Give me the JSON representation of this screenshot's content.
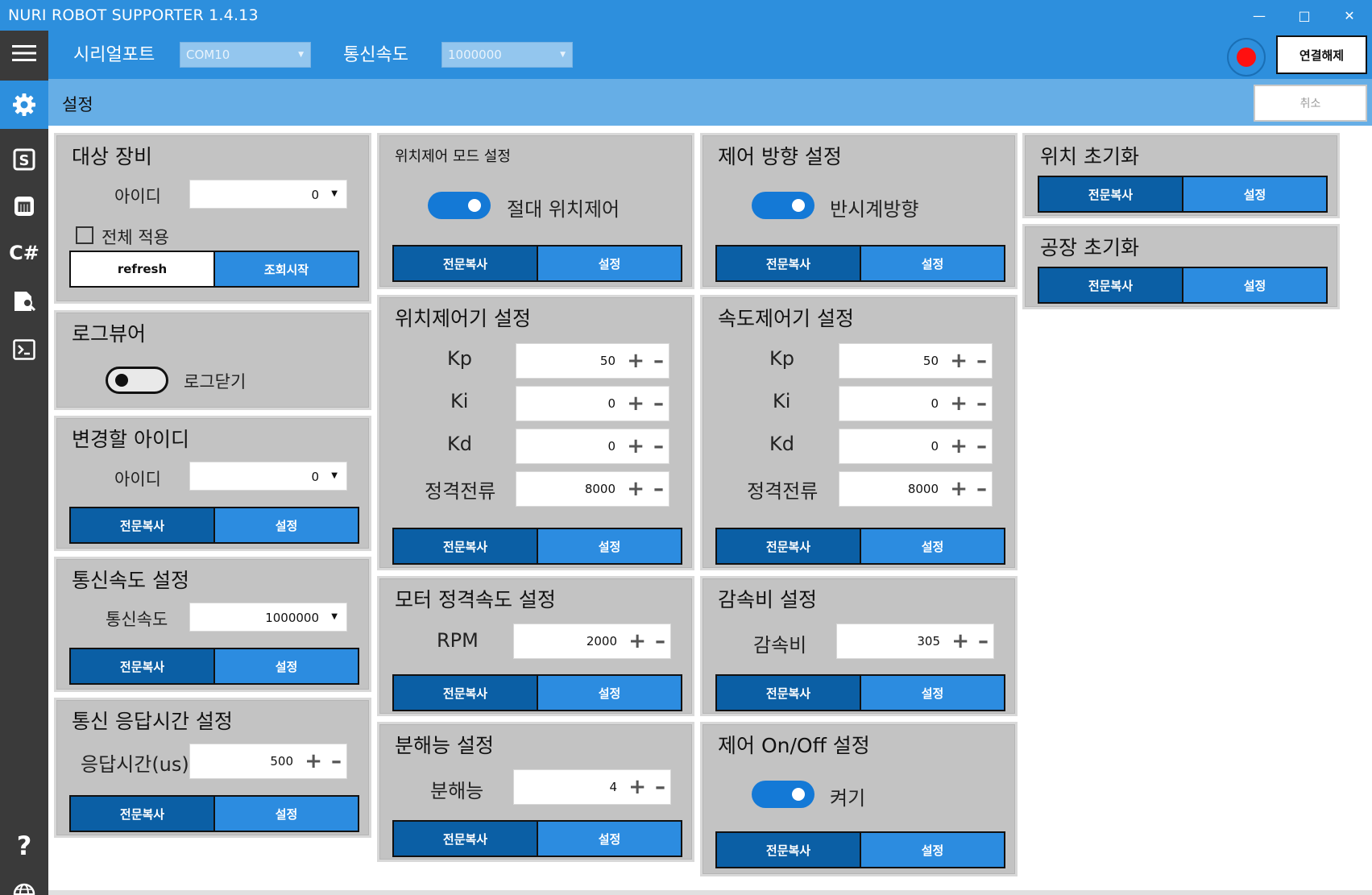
{
  "window": {
    "title": "NURI ROBOT SUPPORTER 1.4.13"
  },
  "topbar": {
    "serial_label": "시리얼포트",
    "serial_value": "COM10",
    "baud_label": "통신속도",
    "baud_value": "1000000",
    "disconnect_label": "연결해제"
  },
  "subheader": {
    "title": "설정",
    "cancel_label": "취소"
  },
  "sidebar": {
    "icons": [
      "menu-icon",
      "gear-icon",
      "s-icon",
      "m-icon",
      "csharp-icon",
      "doc-search-icon",
      "terminal-icon",
      "help-icon",
      "globe-icon"
    ],
    "csharp_text": "C#",
    "help_text": "?"
  },
  "buttons": {
    "copy": "전문복사",
    "set": "설정"
  },
  "target_device": {
    "title": "대상 장비",
    "id_label": "아이디",
    "id_value": "0",
    "apply_all_label": "전체 적용",
    "refresh_label": "refresh",
    "start_query_label": "조회시작"
  },
  "log_viewer": {
    "title": "로그뷰어",
    "toggle_label": "로그닫기"
  },
  "change_id": {
    "title": "변경할 아이디",
    "id_label": "아이디",
    "id_value": "0"
  },
  "baud_setting": {
    "title": "통신속도 설정",
    "label": "통신속도",
    "value": "1000000"
  },
  "response_time": {
    "title": "통신 응답시간 설정",
    "label": "응답시간(us)",
    "value": "500"
  },
  "position_mode": {
    "title": "위치제어 모드 설정",
    "toggle_label": "절대 위치제어"
  },
  "position_controller": {
    "title": "위치제어기 설정",
    "rows": [
      {
        "label": "Kp",
        "value": "50"
      },
      {
        "label": "Ki",
        "value": "0"
      },
      {
        "label": "Kd",
        "value": "0"
      },
      {
        "label": "정격전류",
        "value": "8000"
      }
    ]
  },
  "motor_speed": {
    "title": "모터 정격속도 설정",
    "label": "RPM",
    "value": "2000"
  },
  "resolution": {
    "title": "분해능 설정",
    "label": "분해능",
    "value": "4"
  },
  "direction": {
    "title": "제어 방향 설정",
    "toggle_label": "반시계방향"
  },
  "speed_controller": {
    "title": "속도제어기 설정",
    "rows": [
      {
        "label": "Kp",
        "value": "50"
      },
      {
        "label": "Ki",
        "value": "0"
      },
      {
        "label": "Kd",
        "value": "0"
      },
      {
        "label": "정격전류",
        "value": "8000"
      }
    ]
  },
  "gear_ratio": {
    "title": "감속비 설정",
    "label": "감속비",
    "value": "305"
  },
  "control_onoff": {
    "title": "제어 On/Off 설정",
    "toggle_label": "켜기"
  },
  "position_reset": {
    "title": "위치 초기화"
  },
  "factory_reset": {
    "title": "공장 초기화"
  },
  "colors": {
    "accent": "#2d8fdd",
    "panel": "#c3c3c3",
    "dark_button": "#0b5fa5",
    "light_button": "#2c8ce0",
    "record": "#ff1010"
  }
}
